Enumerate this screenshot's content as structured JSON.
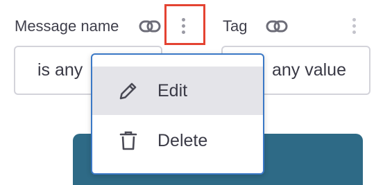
{
  "filters": [
    {
      "label": "Message name",
      "value": "is any",
      "link_icon": "link-icon",
      "more_icon": "more-vertical-icon"
    },
    {
      "label": "Tag",
      "value": "any value",
      "link_icon": "link-icon",
      "more_icon": "more-vertical-icon"
    }
  ],
  "menu": {
    "items": [
      {
        "label": "Edit",
        "icon": "pencil-icon",
        "highlighted": true
      },
      {
        "label": "Delete",
        "icon": "trash-icon",
        "highlighted": false
      }
    ]
  },
  "colors": {
    "highlight_border": "#e44332",
    "menu_border": "#3a78c6",
    "teal_card": "#2e6a86",
    "menu_active_bg": "#e4e4e9"
  }
}
